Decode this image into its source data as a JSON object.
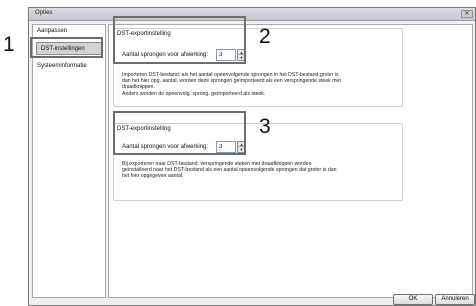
{
  "window": {
    "title": "Opties",
    "close_glyph": "✕"
  },
  "sidebar": {
    "items": [
      {
        "label": "Aanpassen"
      },
      {
        "label": "DST-instellingen"
      },
      {
        "label": "Systeeminformatie"
      }
    ]
  },
  "group1": {
    "title": "DST-exportinstelling",
    "field_label": "Aantal sprongen voor afwerking:",
    "value": "3",
    "description": [
      "Importeren DST-bestand: als het aantal opeenvolgende sprongen in het DST-bestand groter is",
      "dan het hier opg. aantal, worden deze sprongen geïmporteerd als een verspringende steek met",
      "draadknippen.",
      "Anders worden de opeenvolg. sprong. geïmporteerd als steek."
    ]
  },
  "group2": {
    "title": "DST-exportinstelling",
    "field_label": "Aantal sprongen voor afwerking:",
    "value": "3",
    "description": [
      "Bij exporteren naar DST-bestand: verspringende steken met draadknippen worden",
      "geïnstalleerd naar het DST-bestand als een aantal opeenvolgende sprongen dat groter is dan",
      "het hier opgegeven aantal."
    ]
  },
  "spin": {
    "up_glyph": "▲",
    "down_glyph": "▼"
  },
  "callouts": [
    "1",
    "2",
    "3"
  ],
  "buttons": {
    "ok": "OK",
    "cancel": "Annuleren"
  }
}
